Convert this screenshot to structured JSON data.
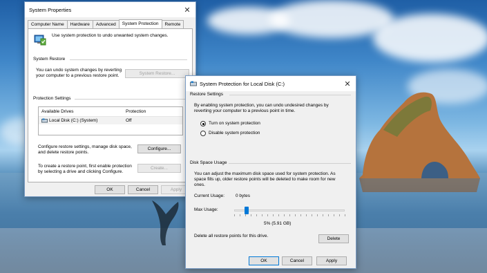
{
  "back_window": {
    "title": "System Properties",
    "tabs": [
      "Computer Name",
      "Hardware",
      "Advanced",
      "System Protection",
      "Remote"
    ],
    "intro": "Use system protection to undo unwanted system changes.",
    "system_restore": {
      "label": "System Restore",
      "text1": "You can undo system changes by reverting",
      "text2": "your computer to a previous restore point.",
      "button": "System Restore..."
    },
    "protection_settings": {
      "label": "Protection Settings",
      "columns": [
        "Available Drives",
        "Protection"
      ],
      "rows": [
        {
          "drive": "Local Disk (C:) (System)",
          "protection": "Off"
        }
      ]
    },
    "configure": {
      "text1": "Configure restore settings, manage disk space,",
      "text2": "and delete restore points.",
      "button": "Configure..."
    },
    "create": {
      "text1": "To create a restore point, first enable protection",
      "text2": "by selecting a drive and clicking Configure.",
      "button": "Create..."
    },
    "buttons": {
      "ok": "OK",
      "cancel": "Cancel",
      "apply": "Apply"
    }
  },
  "front_window": {
    "title": "System Protection for Local Disk (C:)",
    "restore_settings": {
      "label": "Restore Settings",
      "text1": "By enabling system protection, you can undo undesired changes by",
      "text2": "reverting your computer to a previous point in time.",
      "options": [
        {
          "label": "Turn on system protection",
          "checked": true
        },
        {
          "label": "Disable system protection",
          "checked": false
        }
      ]
    },
    "disk_space": {
      "label": "Disk Space Usage",
      "text1": "You can adjust the maximum disk space used for system protection. As",
      "text2": "space fills up, older restore points will be deleted to make room for new",
      "text3": "ones.",
      "current_usage_label": "Current Usage:",
      "current_usage_value": "0 bytes",
      "max_usage_label": "Max Usage:",
      "max_usage_percent": 5,
      "max_usage_text": "5% (5.91 GB)",
      "delete_text": "Delete all restore points for this drive.",
      "delete_button": "Delete"
    },
    "buttons": {
      "ok": "OK",
      "cancel": "Cancel",
      "apply": "Apply"
    }
  }
}
